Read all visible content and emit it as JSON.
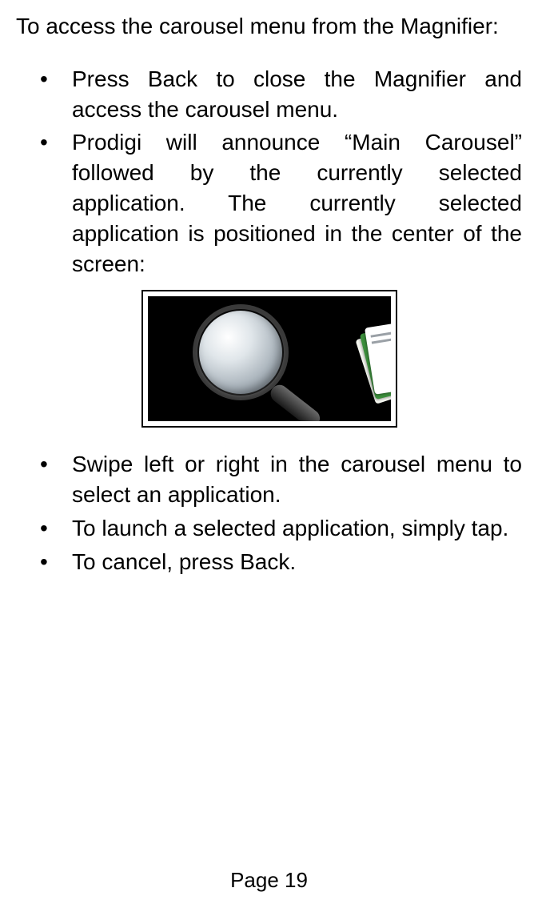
{
  "intro": "To access the carousel menu from the Magnifier:",
  "bullets_top": [
    "Press Back to close the Magnifier and access the carousel menu.",
    "Prodigi will announce “Main Carousel” followed by the currently selected application. The currently selected application is positioned in the center of the screen:"
  ],
  "bullets_bottom": [
    "Swipe left or right in the carousel menu to select an application.",
    "To launch a selected application, simply tap.",
    "To cancel, press Back."
  ],
  "page_label": "Page 19"
}
